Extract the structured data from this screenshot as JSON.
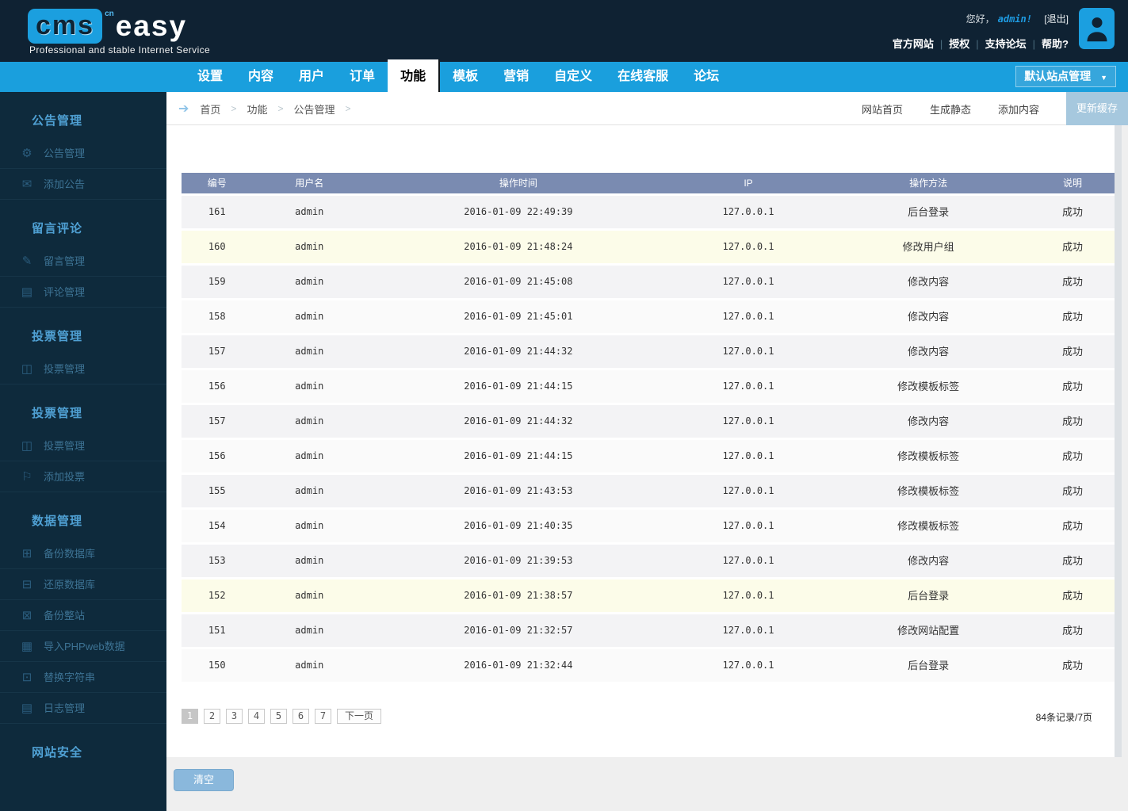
{
  "header": {
    "logo": {
      "cms": "cms",
      "cn": "cn",
      "easy": "easy",
      "tagline": "Professional and stable Internet Service"
    },
    "greeting_prefix": "您好，",
    "username": "admin!",
    "logout": "[退出]",
    "links": [
      "官方网站",
      "授权",
      "支持论坛",
      "帮助?"
    ]
  },
  "navbar": {
    "tabs": [
      {
        "label": "设置",
        "active": false
      },
      {
        "label": "内容",
        "active": false
      },
      {
        "label": "用户",
        "active": false
      },
      {
        "label": "订单",
        "active": false
      },
      {
        "label": "功能",
        "active": true
      },
      {
        "label": "模板",
        "active": false
      },
      {
        "label": "营销",
        "active": false
      },
      {
        "label": "自定义",
        "active": false
      },
      {
        "label": "在线客服",
        "active": false
      },
      {
        "label": "论坛",
        "active": false
      }
    ],
    "site_selector": "默认站点管理",
    "site_selector_arrow": "▼"
  },
  "breadcrumb": {
    "arrow_icon": "➔",
    "items": [
      "首页",
      "功能",
      "公告管理"
    ],
    "actions": [
      "网站首页",
      "生成静态",
      "添加内容"
    ],
    "primary_action": "更新缓存"
  },
  "sidebar": {
    "sections": [
      {
        "title": "公告管理",
        "items": [
          {
            "label": "公告管理",
            "icon": "⚙"
          },
          {
            "label": "添加公告",
            "icon": "✉"
          }
        ]
      },
      {
        "title": "留言评论",
        "items": [
          {
            "label": "留言管理",
            "icon": "✎"
          },
          {
            "label": "评论管理",
            "icon": "▤"
          }
        ]
      },
      {
        "title": "投票管理",
        "items": [
          {
            "label": "投票管理",
            "icon": "◫"
          }
        ]
      },
      {
        "title": "投票管理",
        "items": [
          {
            "label": "投票管理",
            "icon": "◫"
          },
          {
            "label": "添加投票",
            "icon": "⚐"
          }
        ]
      },
      {
        "title": "数据管理",
        "items": [
          {
            "label": "备份数据库",
            "icon": "⊞"
          },
          {
            "label": "还原数据库",
            "icon": "⊟"
          },
          {
            "label": "备份整站",
            "icon": "⊠"
          },
          {
            "label": "导入PHPweb数据",
            "icon": "▦"
          },
          {
            "label": "替换字符串",
            "icon": "⊡"
          },
          {
            "label": "日志管理",
            "icon": "▤"
          }
        ]
      },
      {
        "title": "网站安全",
        "items": []
      }
    ]
  },
  "table": {
    "columns": [
      "编号",
      "用户名",
      "操作时间",
      "IP",
      "操作方法",
      "说明"
    ],
    "rows": [
      {
        "id": "161",
        "user": "admin",
        "time": "2016-01-09 22:49:39",
        "ip": "127.0.0.1",
        "action": "后台登录",
        "result": "成功",
        "highlight": false
      },
      {
        "id": "160",
        "user": "admin",
        "time": "2016-01-09 21:48:24",
        "ip": "127.0.0.1",
        "action": "修改用户组",
        "result": "成功",
        "highlight": true
      },
      {
        "id": "159",
        "user": "admin",
        "time": "2016-01-09 21:45:08",
        "ip": "127.0.0.1",
        "action": "修改内容",
        "result": "成功",
        "highlight": false
      },
      {
        "id": "158",
        "user": "admin",
        "time": "2016-01-09 21:45:01",
        "ip": "127.0.0.1",
        "action": "修改内容",
        "result": "成功",
        "highlight": false
      },
      {
        "id": "157",
        "user": "admin",
        "time": "2016-01-09 21:44:32",
        "ip": "127.0.0.1",
        "action": "修改内容",
        "result": "成功",
        "highlight": false
      },
      {
        "id": "156",
        "user": "admin",
        "time": "2016-01-09 21:44:15",
        "ip": "127.0.0.1",
        "action": "修改模板标签",
        "result": "成功",
        "highlight": false
      },
      {
        "id": "157",
        "user": "admin",
        "time": "2016-01-09 21:44:32",
        "ip": "127.0.0.1",
        "action": "修改内容",
        "result": "成功",
        "highlight": false
      },
      {
        "id": "156",
        "user": "admin",
        "time": "2016-01-09 21:44:15",
        "ip": "127.0.0.1",
        "action": "修改模板标签",
        "result": "成功",
        "highlight": false
      },
      {
        "id": "155",
        "user": "admin",
        "time": "2016-01-09 21:43:53",
        "ip": "127.0.0.1",
        "action": "修改模板标签",
        "result": "成功",
        "highlight": false
      },
      {
        "id": "154",
        "user": "admin",
        "time": "2016-01-09 21:40:35",
        "ip": "127.0.0.1",
        "action": "修改模板标签",
        "result": "成功",
        "highlight": false
      },
      {
        "id": "153",
        "user": "admin",
        "time": "2016-01-09 21:39:53",
        "ip": "127.0.0.1",
        "action": "修改内容",
        "result": "成功",
        "highlight": false
      },
      {
        "id": "152",
        "user": "admin",
        "time": "2016-01-09 21:38:57",
        "ip": "127.0.0.1",
        "action": "后台登录",
        "result": "成功",
        "highlight": true
      },
      {
        "id": "151",
        "user": "admin",
        "time": "2016-01-09 21:32:57",
        "ip": "127.0.0.1",
        "action": "修改网站配置",
        "result": "成功",
        "highlight": false
      },
      {
        "id": "150",
        "user": "admin",
        "time": "2016-01-09 21:32:44",
        "ip": "127.0.0.1",
        "action": "后台登录",
        "result": "成功",
        "highlight": false
      }
    ]
  },
  "pagination": {
    "pages": [
      "1",
      "2",
      "3",
      "4",
      "5",
      "6",
      "7"
    ],
    "active_page": "1",
    "next": "下一页",
    "record_info": "84条记录/7页"
  },
  "footer": {
    "clear_button": "清空"
  },
  "colors": {
    "header_bg": "#0f2233",
    "sidebar_bg": "#0e2a3c",
    "nav_blue": "#1a9fdd",
    "table_header_bg": "#7a8bb1",
    "highlight_row": "#fcfce9",
    "accent_blue": "#1b9fdf"
  }
}
